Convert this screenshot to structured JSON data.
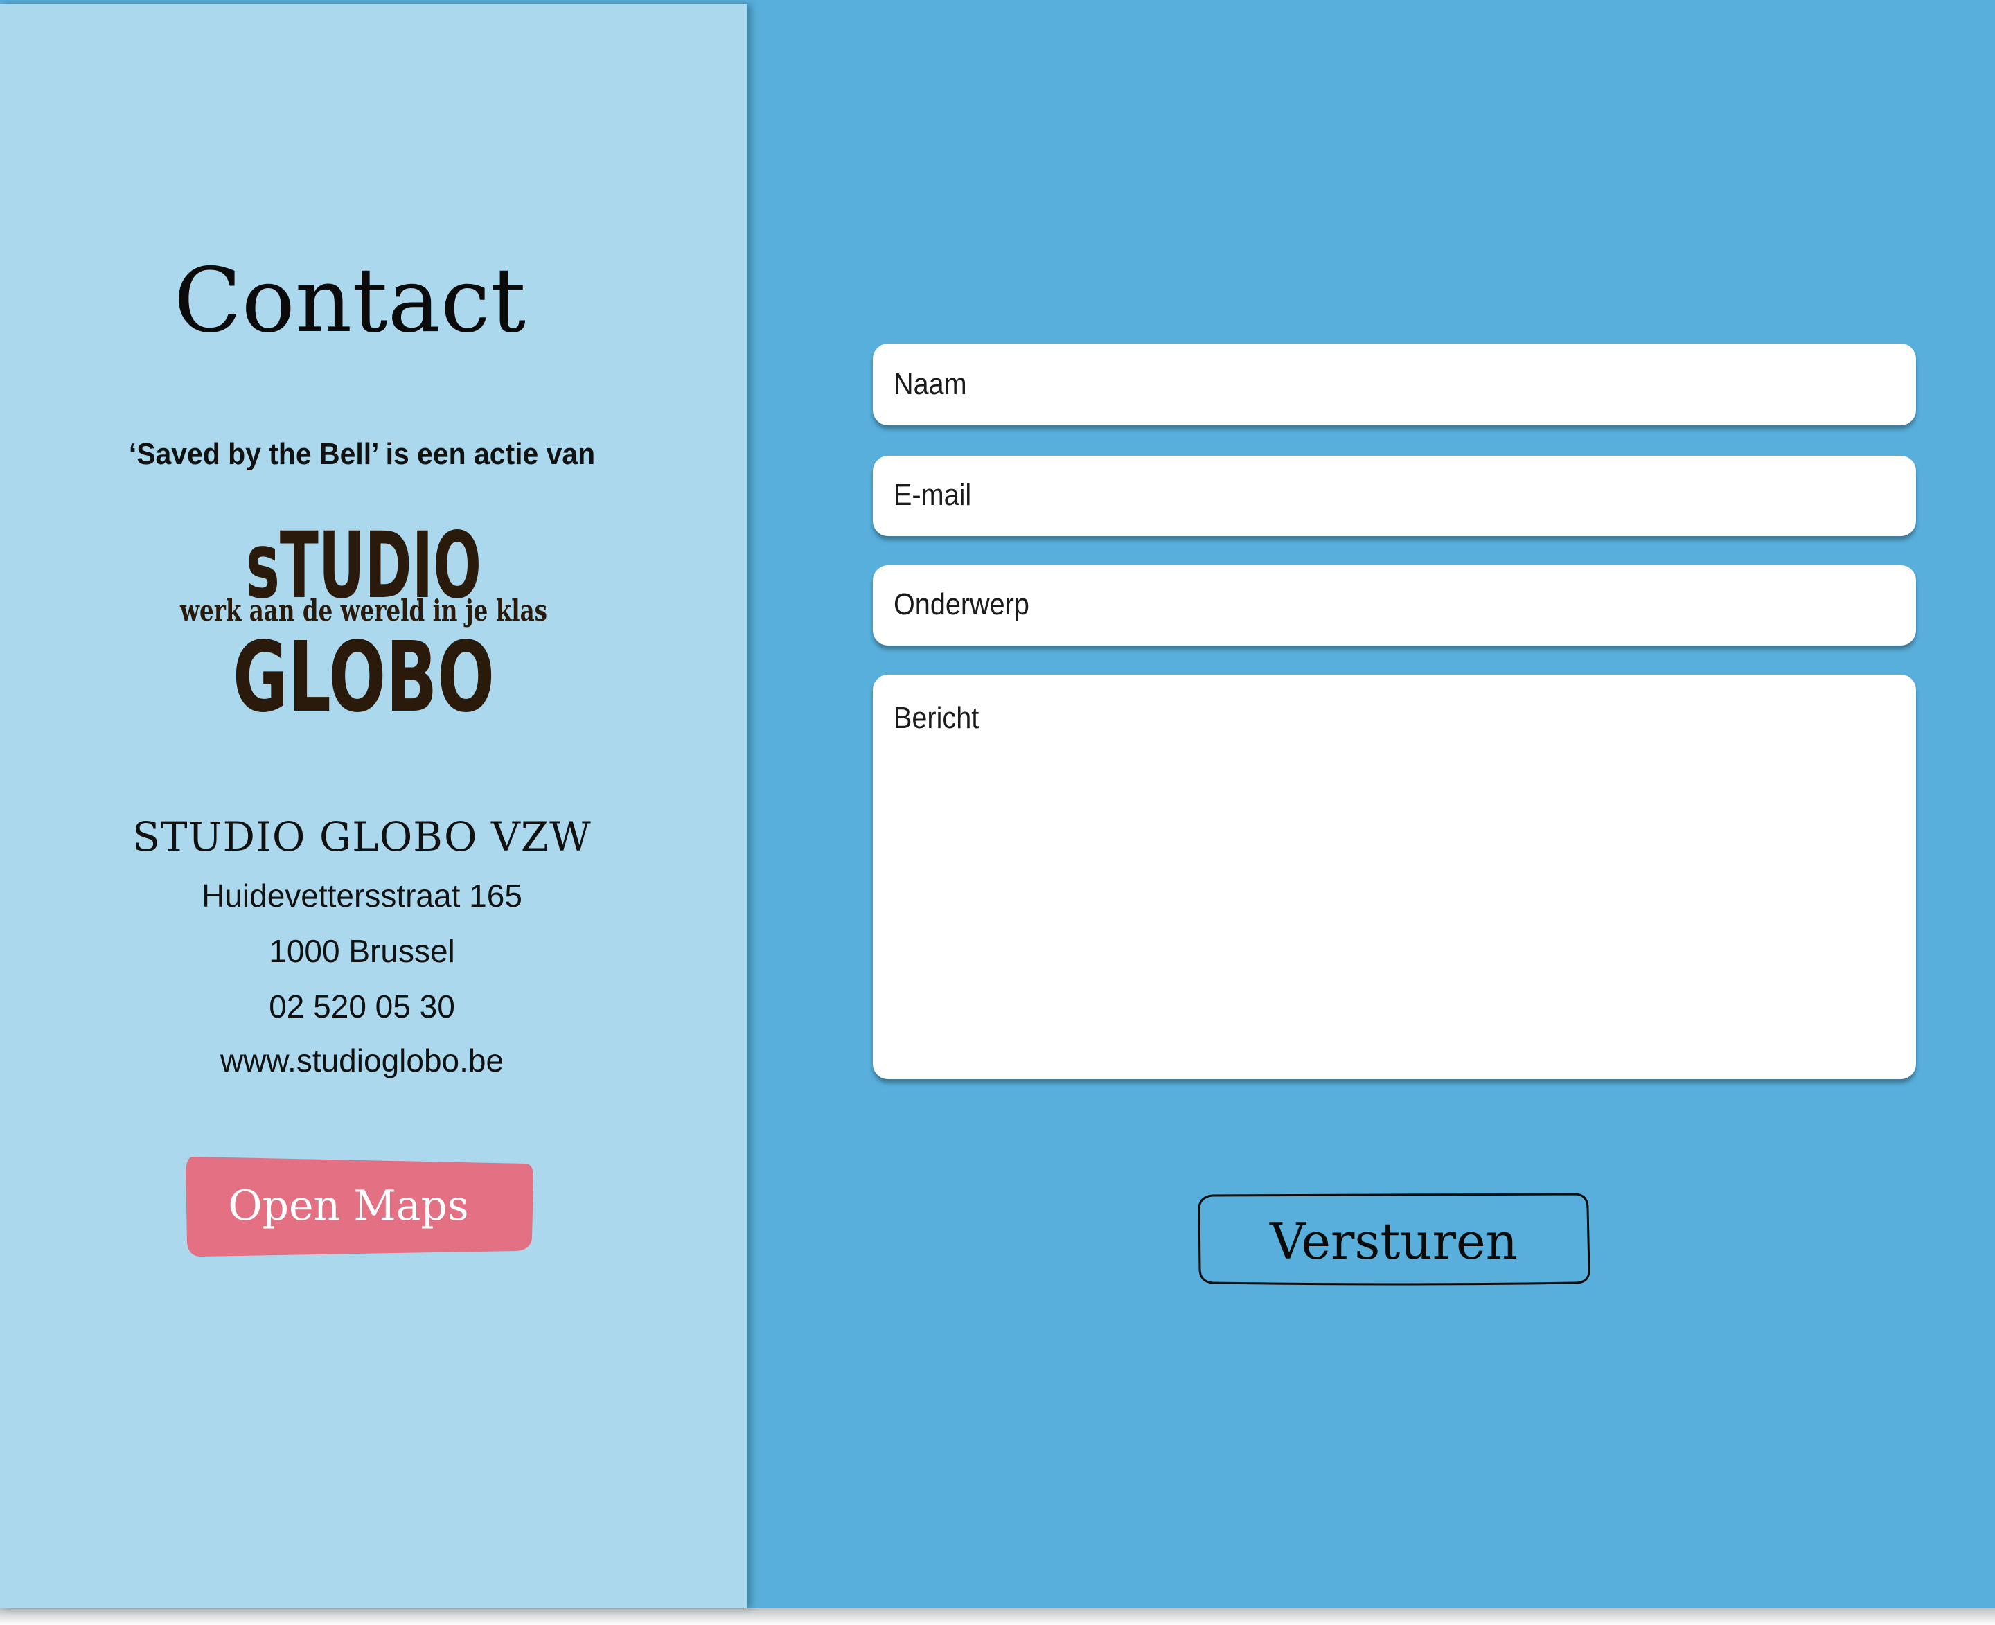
{
  "contact": {
    "title": "Contact",
    "tagline": "‘Saved by the Bell’ is een actie van",
    "logo": {
      "top_word": "sTUDIO",
      "slogan": "werk aan de wereld in je klas",
      "bottom_word": "GLOBO",
      "color": "#2a1a0b"
    },
    "organization": "STUDIO GLOBO VZW",
    "address_street": "Huidevettersstraat 165",
    "address_city": "1000 Brussel",
    "phone": "02 520 05 30",
    "website": "www.studioglobo.be",
    "maps_button_label": "Open Maps"
  },
  "form": {
    "name_placeholder": "Naam",
    "email_placeholder": "E-mail",
    "subject_placeholder": "Onderwerp",
    "message_placeholder": "Bericht",
    "submit_label": "Versturen"
  },
  "colors": {
    "page_background": "#58afdb",
    "left_panel": "#abd8ed",
    "maps_button": "#e37183",
    "field_background": "#ffffff"
  }
}
